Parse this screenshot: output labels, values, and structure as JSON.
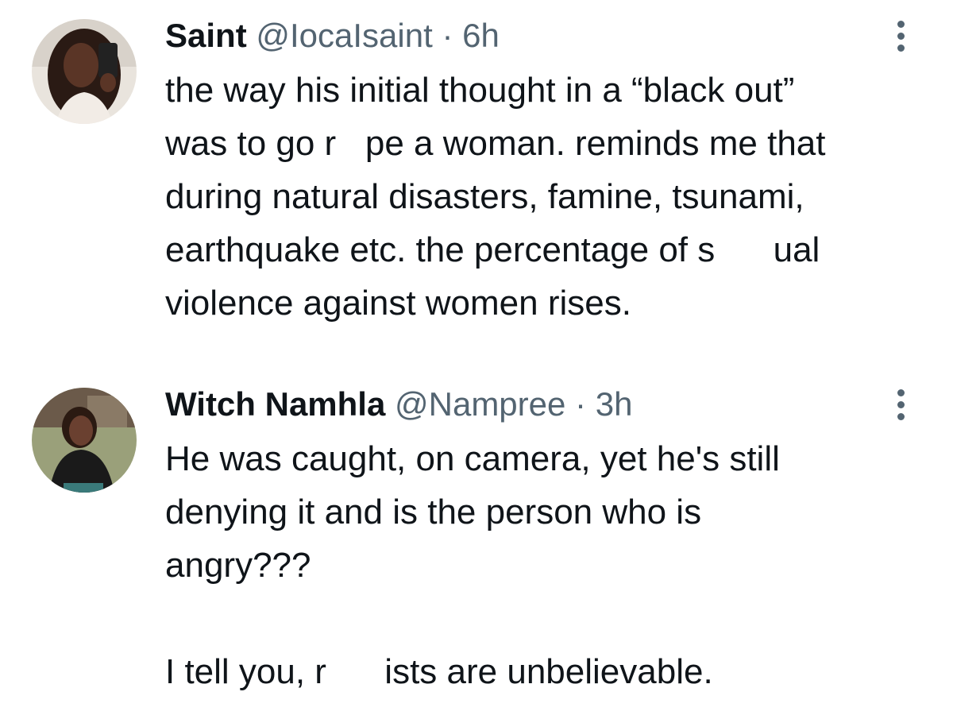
{
  "tweets": [
    {
      "display_name": "Saint",
      "handle": "@IocaIsaint",
      "separator": "·",
      "time": "6h",
      "avatar_icon": "avatar-photo-icon",
      "more_icon": "more-vertical-icon",
      "lines": [
        "the way his initial thought in a “black out”",
        "was to go r   pe a woman. reminds me that",
        "during natural disasters, famine, tsunami,",
        "earthquake etc. the percentage of s      ual",
        "violence against women rises."
      ]
    },
    {
      "display_name": "Witch Namhla",
      "handle": "@Nampree",
      "separator": "·",
      "time": "3h",
      "avatar_icon": "avatar-photo-icon",
      "more_icon": "more-vertical-icon",
      "lines": [
        "He was caught, on camera, yet he's still",
        "denying it and is the person who is",
        "angry???",
        "",
        "I tell you, r      ists are unbelievable."
      ]
    }
  ],
  "colors": {
    "text_primary": "#0f1419",
    "text_secondary": "#536471",
    "background": "#ffffff"
  }
}
